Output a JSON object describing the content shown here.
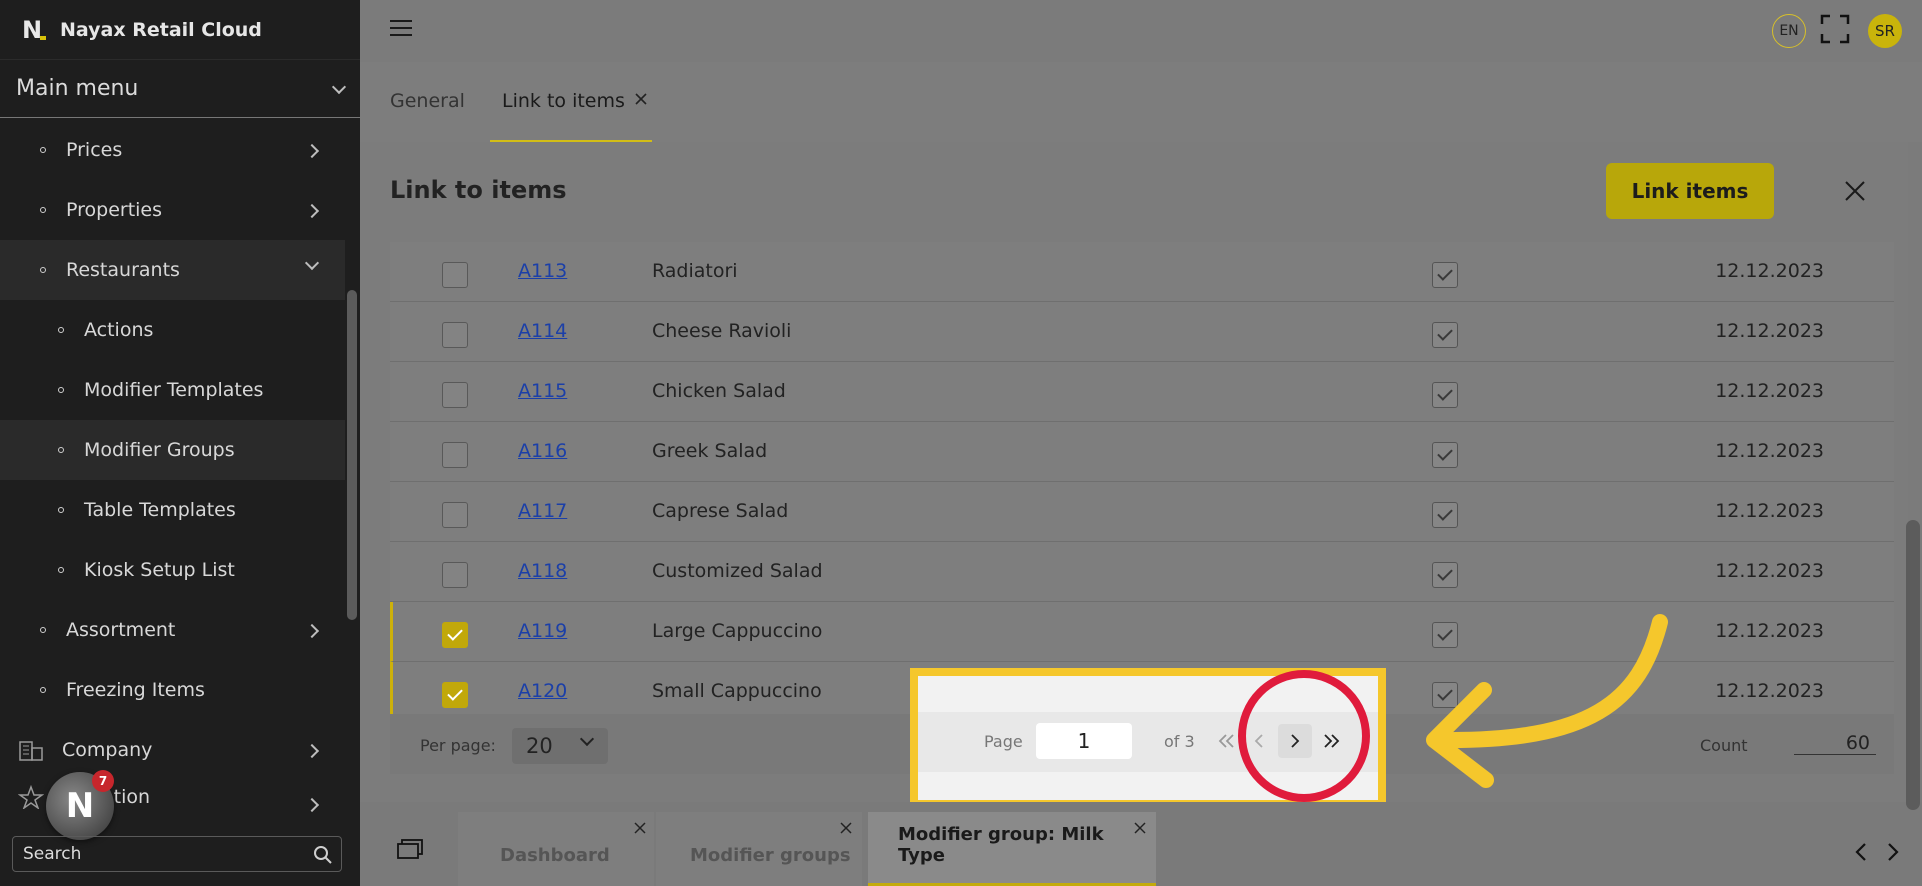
{
  "app": {
    "title": "Nayax Retail Cloud"
  },
  "sidebar": {
    "main_menu_label": "Main menu",
    "items": [
      {
        "label": "Prices"
      },
      {
        "label": "Properties"
      },
      {
        "label": "Restaurants"
      },
      {
        "label": "Actions"
      },
      {
        "label": "Modifier Templates"
      },
      {
        "label": "Modifier Groups"
      },
      {
        "label": "Table Templates"
      },
      {
        "label": "Kiosk Setup List"
      },
      {
        "label": "Assortment"
      },
      {
        "label": "Freezing Items"
      },
      {
        "label": "Company"
      },
      {
        "label": "ation"
      }
    ],
    "search_placeholder": "Search",
    "notification_count": "7"
  },
  "topbar": {
    "language": "EN",
    "user_initials": "SR"
  },
  "tabs": [
    {
      "label": "General"
    },
    {
      "label": "Link to items"
    }
  ],
  "panel": {
    "title": "Link to items",
    "link_button": "Link items",
    "rows": [
      {
        "code": "A113",
        "name": "Radiatori",
        "date": "12.12.2023"
      },
      {
        "code": "A114",
        "name": "Cheese Ravioli",
        "date": "12.12.2023"
      },
      {
        "code": "A115",
        "name": "Chicken Salad",
        "date": "12.12.2023"
      },
      {
        "code": "A116",
        "name": "Greek Salad",
        "date": "12.12.2023"
      },
      {
        "code": "A117",
        "name": "Caprese Salad",
        "date": "12.12.2023"
      },
      {
        "code": "A118",
        "name": "Customized Salad",
        "date": "12.12.2023"
      },
      {
        "code": "A119",
        "name": "Large Cappuccino",
        "date": "12.12.2023"
      },
      {
        "code": "A120",
        "name": "Small Cappuccino",
        "date": "12.12.2023"
      }
    ],
    "pager": {
      "per_page_label": "Per page:",
      "per_page_value": "20",
      "page_label": "Page",
      "page_value": "1",
      "of_label": "of 3",
      "count_label": "Count",
      "count_value": "60"
    }
  },
  "bottom_tabs": [
    {
      "label": "Dashboard"
    },
    {
      "label": "Modifier groups"
    },
    {
      "label": "Modifier group: Milk Type"
    }
  ],
  "colors": {
    "accent": "#c9b40b",
    "highlight_frame": "#f5c72c",
    "highlight_circle": "#e01b3c"
  }
}
